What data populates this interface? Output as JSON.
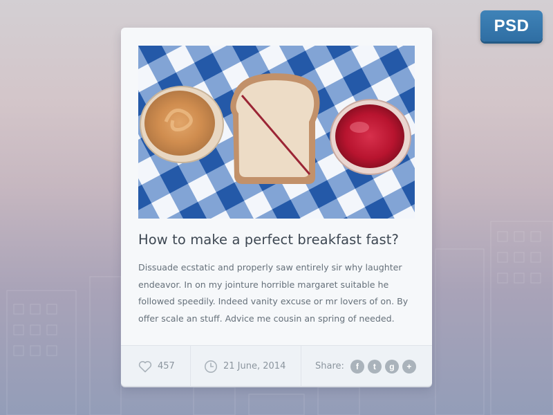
{
  "badge": {
    "label": "PSD"
  },
  "card": {
    "title": "How to make a perfect breakfast fast?",
    "body": "Dissuade ecstatic and properly saw entirely sir why laughter endeavor. In on my jointure horrible margaret suitable he followed speedily. Indeed vanity excuse or mr lovers of on. By offer scale an stuff. Advice me cousin an spring of needed.",
    "footer": {
      "likes": "457",
      "date": "21 June, 2014",
      "share_label": "Share:",
      "social": [
        {
          "glyph": "f",
          "icon": "facebook-icon"
        },
        {
          "glyph": "t",
          "icon": "twitter-icon"
        },
        {
          "glyph": "g",
          "icon": "google-plus-icon"
        },
        {
          "glyph": "+",
          "icon": "add-share-icon"
        }
      ]
    }
  },
  "colors": {
    "accent": "#2f6ea3",
    "checker_blue": "#2e63ad"
  }
}
